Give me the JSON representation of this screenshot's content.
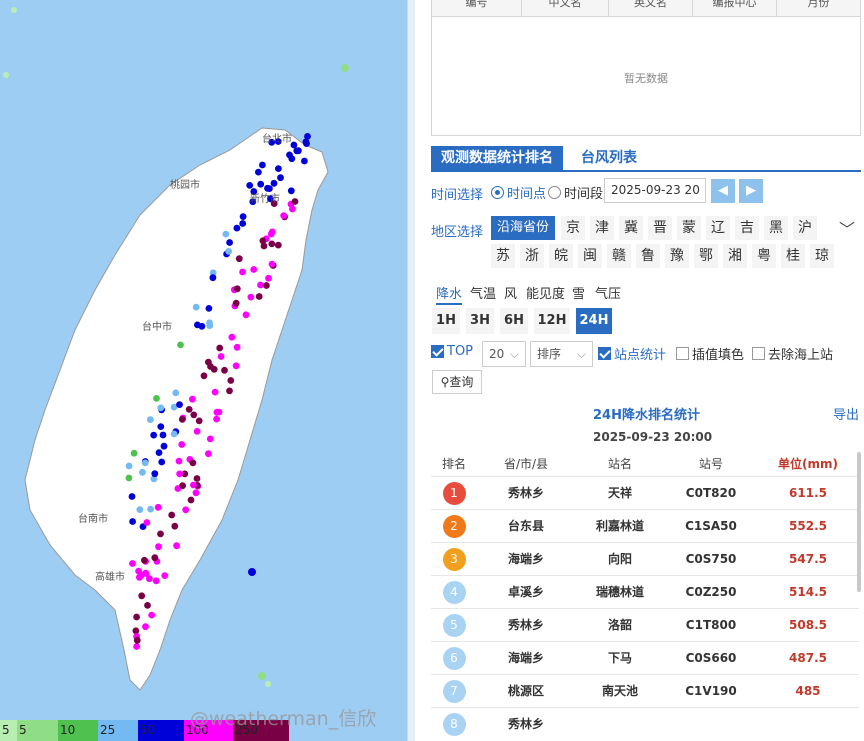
{
  "map": {
    "cities": [
      "台北市",
      "桃园市",
      "新竹市",
      "台中市",
      "台南市",
      "高雄市"
    ],
    "legend": [
      {
        "label": "5",
        "color": "#b9eeb2"
      },
      {
        "label": "5",
        "color": "#8fdd87"
      },
      {
        "label": "10",
        "color": "#4fc14f"
      },
      {
        "label": "25",
        "color": "#73b9f2"
      },
      {
        "label": "50",
        "color": "#0000d8"
      },
      {
        "label": "100",
        "color": "#ff00ff"
      },
      {
        "label": "250",
        "color": "#7a0046"
      }
    ]
  },
  "top_table": {
    "headers": [
      "编号",
      "中文名",
      "英文名",
      "编报中心",
      "月份"
    ],
    "empty_text": "暂无数据"
  },
  "tabs": {
    "active": "观测数据统计排名",
    "inactive": "台风列表"
  },
  "time": {
    "label": "时间选择",
    "opt1": "时间点",
    "opt2": "时间段",
    "date": "2025-09-23 20"
  },
  "region": {
    "label": "地区选择",
    "active": "沿海省份",
    "row1": [
      "京",
      "津",
      "冀",
      "晋",
      "蒙",
      "辽",
      "吉",
      "黑",
      "沪"
    ],
    "row2": [
      "苏",
      "浙",
      "皖",
      "闽",
      "赣",
      "鲁",
      "豫",
      "鄂",
      "湘",
      "粤",
      "桂",
      "琼"
    ]
  },
  "elements": [
    "降水",
    "气温",
    "风",
    "能见度",
    "雪",
    "气压"
  ],
  "hours": [
    "1H",
    "3H",
    "6H",
    "12H",
    "24H"
  ],
  "options": {
    "top_label": "TOP",
    "top_value": "20",
    "sort_placeholder": "排序",
    "station_stats": "站点统计",
    "interp": "插值填色",
    "remove_sea": "去除海上站",
    "query": "查询"
  },
  "ranking": {
    "title": "24H降水排名统计",
    "export": "导出",
    "time": "2025-09-23 20:00",
    "headers": [
      "排名",
      "省/市/县",
      "站名",
      "站号",
      "单位(mm)"
    ],
    "rows": [
      {
        "rank": "1",
        "county": "秀林乡",
        "name": "天祥",
        "id": "C0T820",
        "value": "611.5",
        "color": "#e84c3d"
      },
      {
        "rank": "2",
        "county": "台东县",
        "name": "利嘉林道",
        "id": "C1SA50",
        "value": "552.5",
        "color": "#f07a1a"
      },
      {
        "rank": "3",
        "county": "海端乡",
        "name": "向阳",
        "id": "C0S750",
        "value": "547.5",
        "color": "#f0a01e"
      },
      {
        "rank": "4",
        "county": "卓溪乡",
        "name": "瑞穗林道",
        "id": "C0Z250",
        "value": "514.5",
        "color": "#a9d3f3"
      },
      {
        "rank": "5",
        "county": "秀林乡",
        "name": "洛韶",
        "id": "C1T800",
        "value": "508.5",
        "color": "#a9d3f3"
      },
      {
        "rank": "6",
        "county": "海端乡",
        "name": "下马",
        "id": "C0S660",
        "value": "487.5",
        "color": "#a9d3f3"
      },
      {
        "rank": "7",
        "county": "桃源区",
        "name": "南天池",
        "id": "C1V190",
        "value": "485",
        "color": "#a9d3f3"
      },
      {
        "rank": "8",
        "county": "秀林乡",
        "name": "",
        "id": "",
        "value": "",
        "color": "#a9d3f3"
      }
    ]
  },
  "watermark": "@weatherman_信欣"
}
